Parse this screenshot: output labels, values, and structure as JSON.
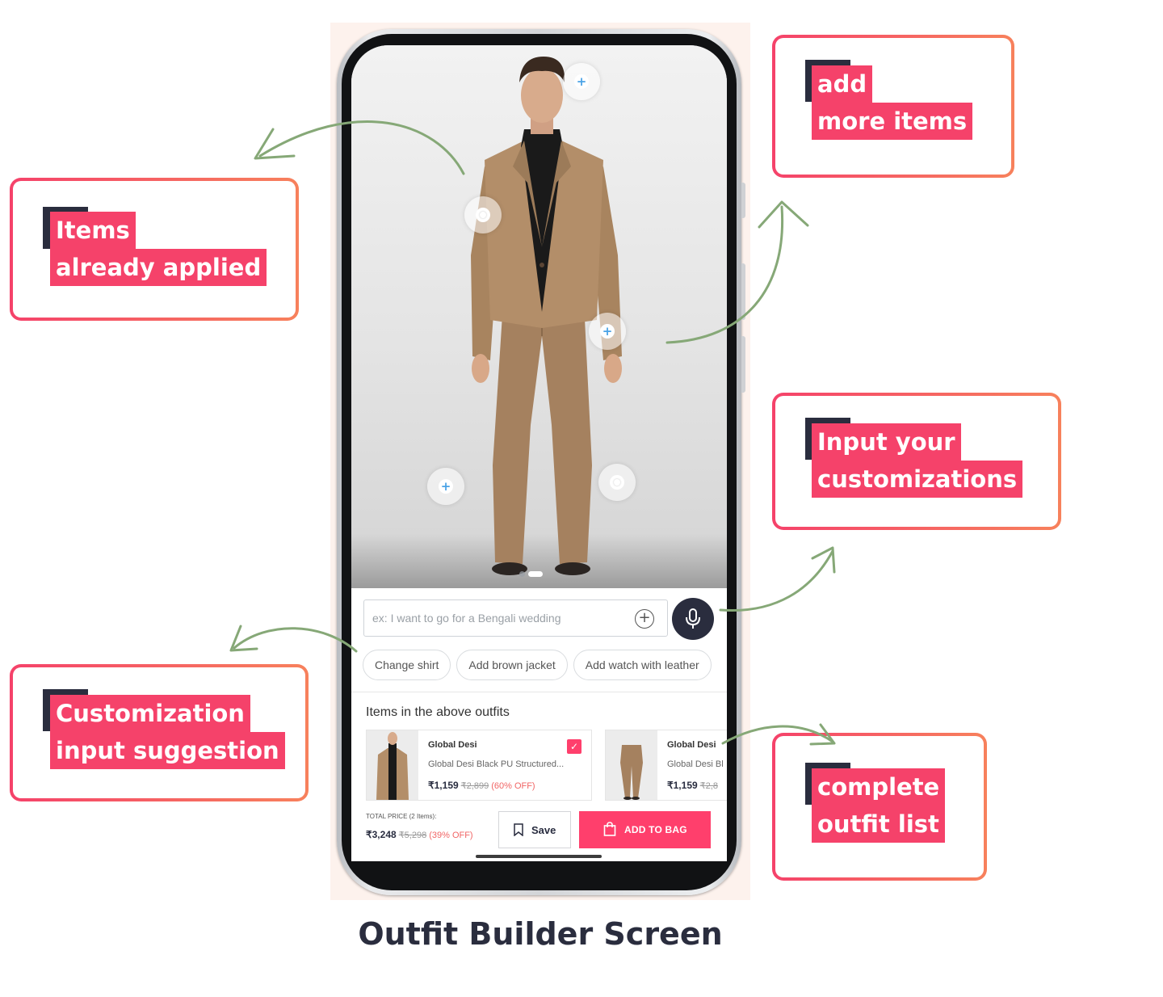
{
  "colors": {
    "accent_pink": "#f5426a",
    "accent_orange": "#f7815c",
    "dark_navy": "#2a2d3e",
    "arrow_green": "#86a877",
    "brand_pink": "#ff3f6c"
  },
  "callouts": {
    "items_applied": [
      "Items",
      "already applied"
    ],
    "add_more": [
      "add",
      "more items"
    ],
    "input_custom": [
      "Input your",
      "customizations"
    ],
    "suggestion": [
      "Customization",
      "input suggestion"
    ],
    "outfit_list": [
      "complete",
      "outfit list"
    ]
  },
  "screen_title": "Outfit Builder Screen",
  "app": {
    "hotspots": [
      {
        "icon": "plus-icon"
      },
      {
        "icon": "dot-icon"
      },
      {
        "icon": "plus-icon"
      },
      {
        "icon": "plus-icon"
      },
      {
        "icon": "dot-icon"
      }
    ],
    "carousel": {
      "pages": 2,
      "active": 1
    },
    "search": {
      "placeholder": "ex: I want to go for a Bengali wedding",
      "value": "",
      "add_icon": "plus-circle-icon",
      "mic_icon": "microphone-icon"
    },
    "suggestions": [
      "Change shirt",
      "Add brown jacket",
      "Add watch with leather"
    ],
    "items_title": "Items in the above outfits",
    "products": [
      {
        "brand": "Global Desi",
        "name": "Global Desi Black PU Structured...",
        "price": "₹1,159",
        "mrp": "₹2,899",
        "discount": "(60% OFF)",
        "checked": true
      },
      {
        "brand": "Global Desi",
        "name": "Global Desi Bl",
        "price": "₹1,159",
        "mrp": "₹2,8"
      }
    ],
    "total": {
      "label": "TOTAL PRICE (2 Items):",
      "price": "₹3,248",
      "mrp": "₹5,298",
      "discount": "(39% OFF)"
    },
    "save_label": "Save",
    "bag_label": "ADD TO BAG"
  }
}
